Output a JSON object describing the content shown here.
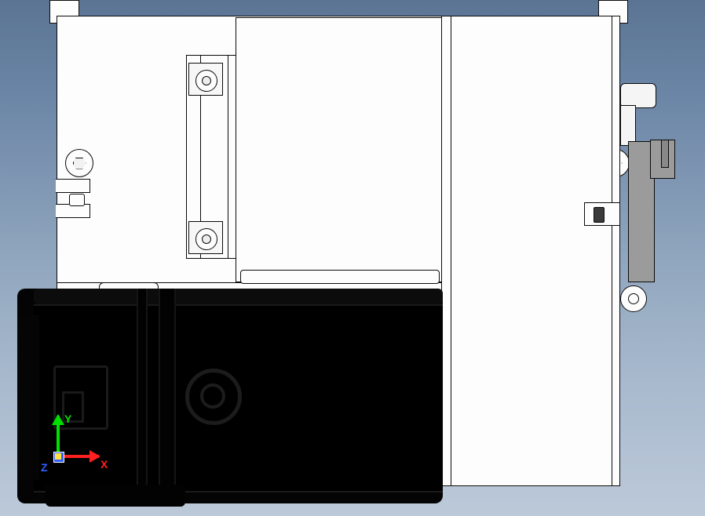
{
  "axes": {
    "x_label": "X",
    "y_label": "Y",
    "z_label": "Z"
  },
  "colors": {
    "bg_top": "#5b7494",
    "bg_bottom": "#bcc9d9",
    "body": "#fdfdfd",
    "edge": "#0a0a0a",
    "motor": "#040404",
    "bracket_dark": "#9b9b9b",
    "axis_x": "#ff2020",
    "axis_y": "#00e000",
    "axis_z": "#3060ff"
  },
  "icons": {
    "triad": "orientation-triad-icon",
    "hex_bolt": "hex-bolt-icon",
    "socket_bolt": "socket-bolt-icon",
    "ring": "ring-feature-icon"
  }
}
